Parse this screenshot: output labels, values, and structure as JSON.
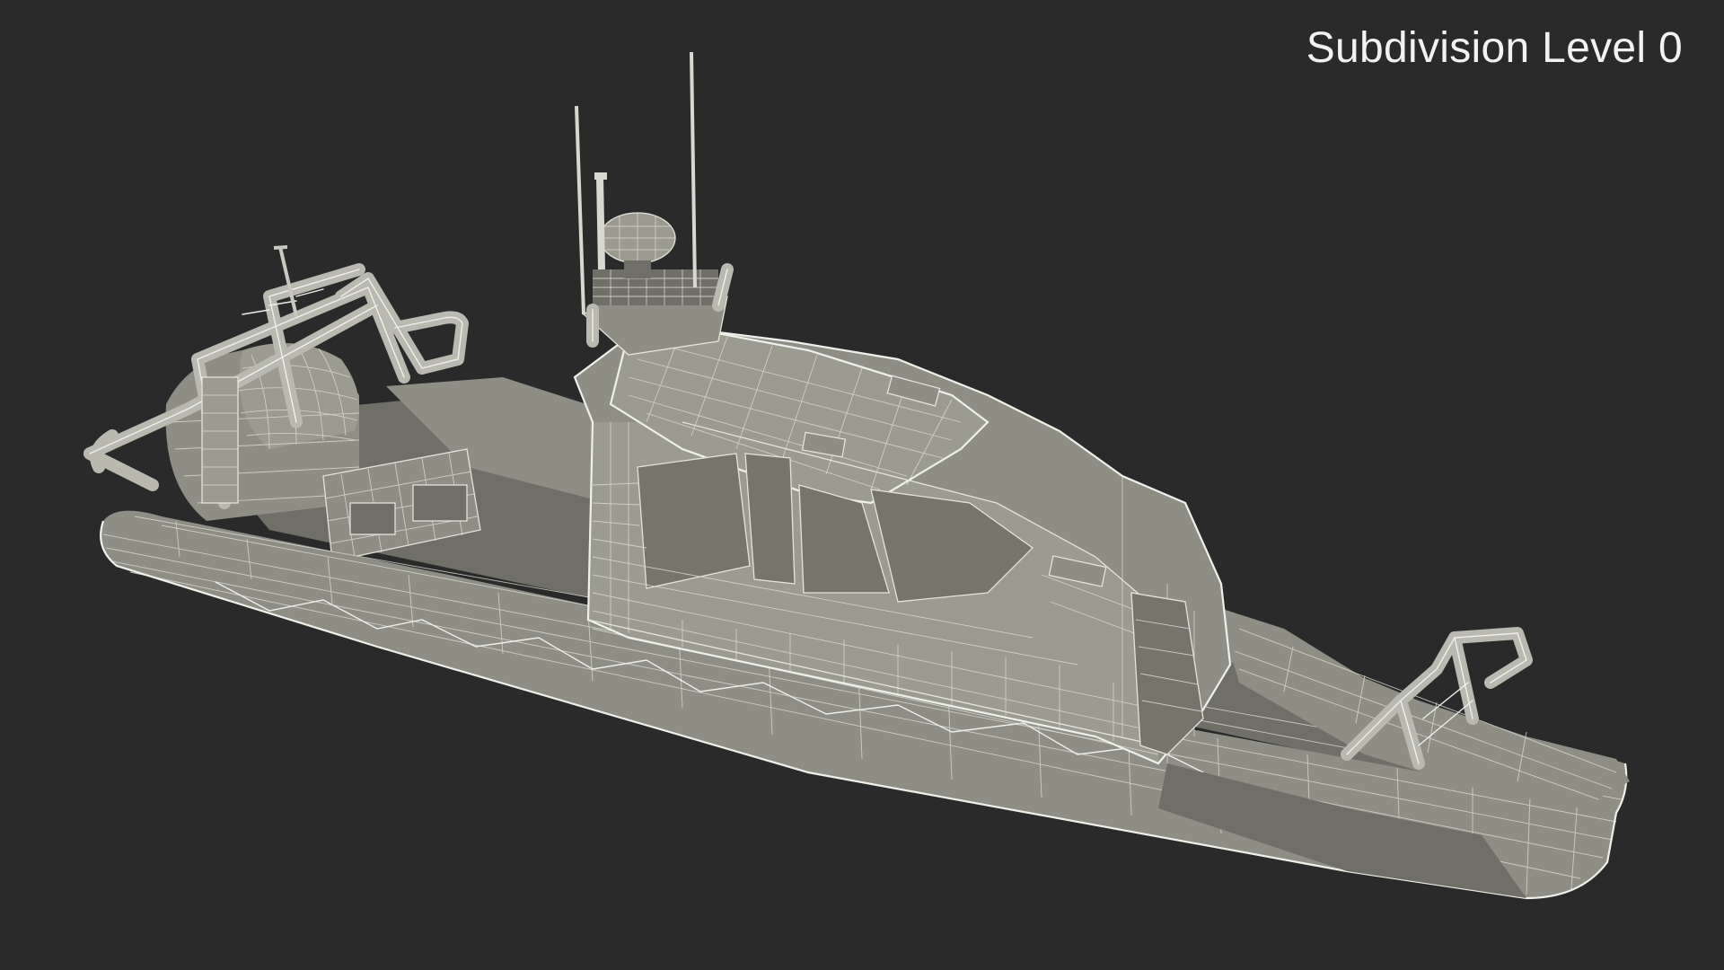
{
  "viewport": {
    "label": "Subdivision Level 0",
    "background": "#2a2a2a",
    "model_color": "#8e8e84",
    "wire_color": "#e4e4dc"
  }
}
